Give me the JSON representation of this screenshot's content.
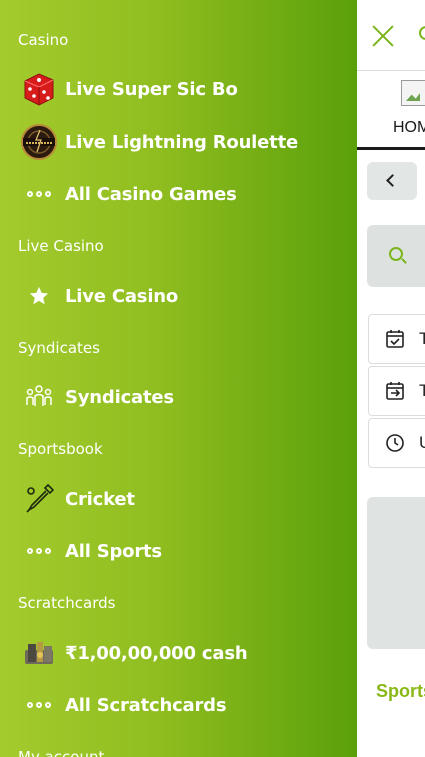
{
  "menu": {
    "sections": [
      {
        "title": "Casino",
        "items": [
          {
            "label": "Live Super Sic Bo",
            "icon": "red-dice-icon"
          },
          {
            "label": "Live Lightning Roulette",
            "icon": "lightning-roulette-logo-icon"
          },
          {
            "label": "All Casino Games",
            "icon": "more-dots-icon"
          }
        ]
      },
      {
        "title": "Live Casino",
        "items": [
          {
            "label": "Live Casino",
            "icon": "star-icon"
          }
        ]
      },
      {
        "title": "Syndicates",
        "items": [
          {
            "label": "Syndicates",
            "icon": "people-group-icon"
          }
        ]
      },
      {
        "title": "Sportsbook",
        "items": [
          {
            "label": "Cricket",
            "icon": "cricket-bat-icon"
          },
          {
            "label": "All Sports",
            "icon": "more-dots-icon"
          }
        ]
      },
      {
        "title": "Scratchcards",
        "items": [
          {
            "label": "₹1,00,00,000 cash",
            "icon": "scratchcard-cash-icon"
          },
          {
            "label": "All Scratchcards",
            "icon": "more-dots-icon"
          }
        ]
      },
      {
        "title": "My account",
        "items": []
      }
    ]
  },
  "page": {
    "home_label": "HOME",
    "quick_links": [
      {
        "label": "T",
        "icon": "calendar-check-icon"
      },
      {
        "label": "T",
        "icon": "calendar-arrow-icon"
      },
      {
        "label": "U",
        "icon": "clock-icon"
      }
    ],
    "sports_heading": "Sports"
  },
  "colors": {
    "drawer_gradient_start": "#a4cb2e",
    "drawer_gradient_end": "#5aa00a",
    "accent": "#7bb51c"
  }
}
